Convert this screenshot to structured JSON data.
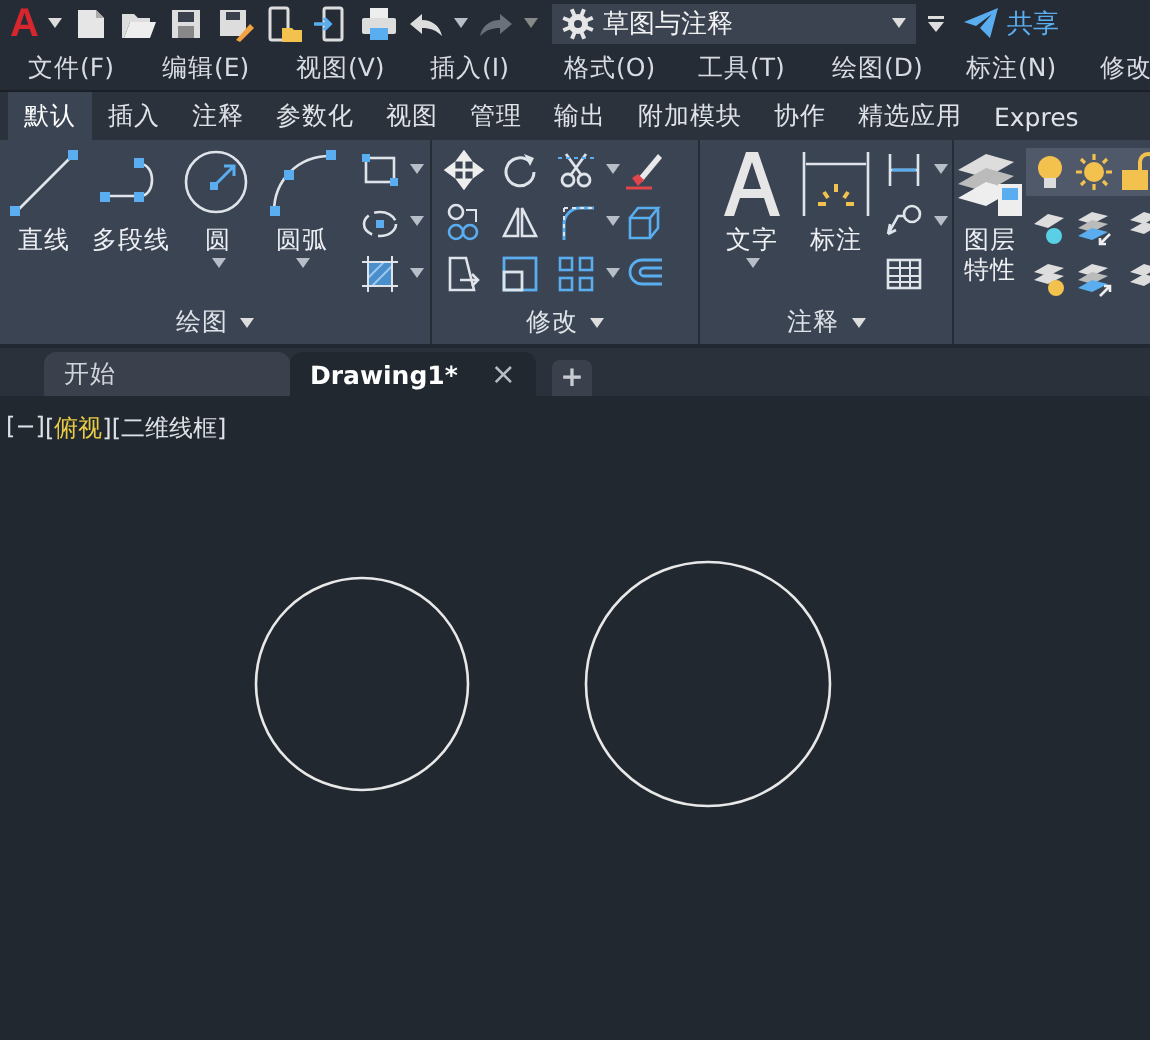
{
  "quick_access": {
    "app_logo": "A",
    "workspace": "草图与注释",
    "share": "共享"
  },
  "menu_bar": [
    {
      "label": "文件(F)"
    },
    {
      "label": "编辑(E)"
    },
    {
      "label": "视图(V)"
    },
    {
      "label": "插入(I)"
    },
    {
      "label": "格式(O)"
    },
    {
      "label": "工具(T)"
    },
    {
      "label": "绘图(D)"
    },
    {
      "label": "标注(N)"
    },
    {
      "label": "修改"
    }
  ],
  "ribbon_tabs": [
    {
      "label": "默认",
      "selected": true
    },
    {
      "label": "插入",
      "selected": false
    },
    {
      "label": "注释",
      "selected": false
    },
    {
      "label": "参数化",
      "selected": false
    },
    {
      "label": "视图",
      "selected": false
    },
    {
      "label": "管理",
      "selected": false
    },
    {
      "label": "输出",
      "selected": false
    },
    {
      "label": "附加模块",
      "selected": false
    },
    {
      "label": "协作",
      "selected": false
    },
    {
      "label": "精选应用",
      "selected": false
    },
    {
      "label": "Expres",
      "selected": false
    }
  ],
  "ribbon_panels": [
    {
      "title": "绘图",
      "buttons": [
        {
          "label": "直线",
          "has_menu": false
        },
        {
          "label": "多段线",
          "has_menu": false
        },
        {
          "label": "圆",
          "has_menu": true
        },
        {
          "label": "圆弧",
          "has_menu": true
        }
      ]
    },
    {
      "title": "修改"
    },
    {
      "title": "注释",
      "buttons": [
        {
          "label": "文字",
          "has_menu": true
        },
        {
          "label": "标注",
          "has_menu": false
        }
      ]
    },
    {
      "buttons": [
        {
          "label": "图层特性",
          "has_menu": false
        }
      ]
    }
  ],
  "document_tabs": [
    {
      "label": "开始",
      "selected": false
    },
    {
      "label": "Drawing1*",
      "selected": true,
      "close": "×"
    }
  ],
  "new_tab": "+",
  "viewport_controls": [
    {
      "left": "[",
      "label": "−",
      "right": "]",
      "highlighted": false
    },
    {
      "left": "[",
      "label": "俯视",
      "right": "]",
      "highlighted": true
    },
    {
      "left": "[",
      "label": "二维线框",
      "right": "]",
      "highlighted": false
    }
  ],
  "drawing": {
    "objects": [
      {
        "kind": "circle"
      },
      {
        "kind": "circle"
      }
    ]
  }
}
